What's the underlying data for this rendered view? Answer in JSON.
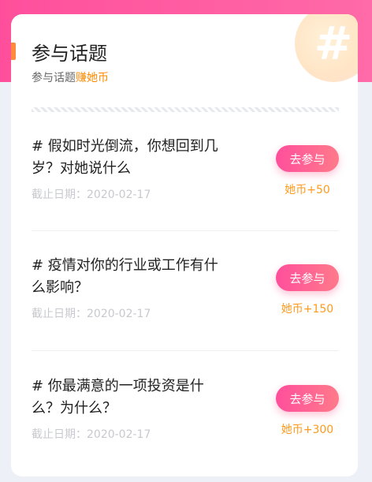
{
  "header": {
    "title": "参与话题",
    "subtitle_prefix": "参与话题",
    "subtitle_accent": "赚她币",
    "decor_icon": "hash-icon"
  },
  "topics": [
    {
      "title": "# 假如时光倒流，你想回到几岁？对她说什么",
      "deadline": "截止日期：2020-02-17",
      "button": "去参与",
      "reward": "她币+50"
    },
    {
      "title": "# 疫情对你的行业或工作有什么影响？",
      "deadline": "截止日期：2020-02-17",
      "button": "去参与",
      "reward": "她币+150"
    },
    {
      "title": "# 你最满意的一项投资是什么？为什么？",
      "deadline": "截止日期：2020-02-17",
      "button": "去参与",
      "reward": "她币+300"
    }
  ],
  "colors": {
    "brand_pink": "#ff4f9c",
    "accent_orange": "#ff8a00",
    "reward_orange": "#ff9a1e"
  }
}
